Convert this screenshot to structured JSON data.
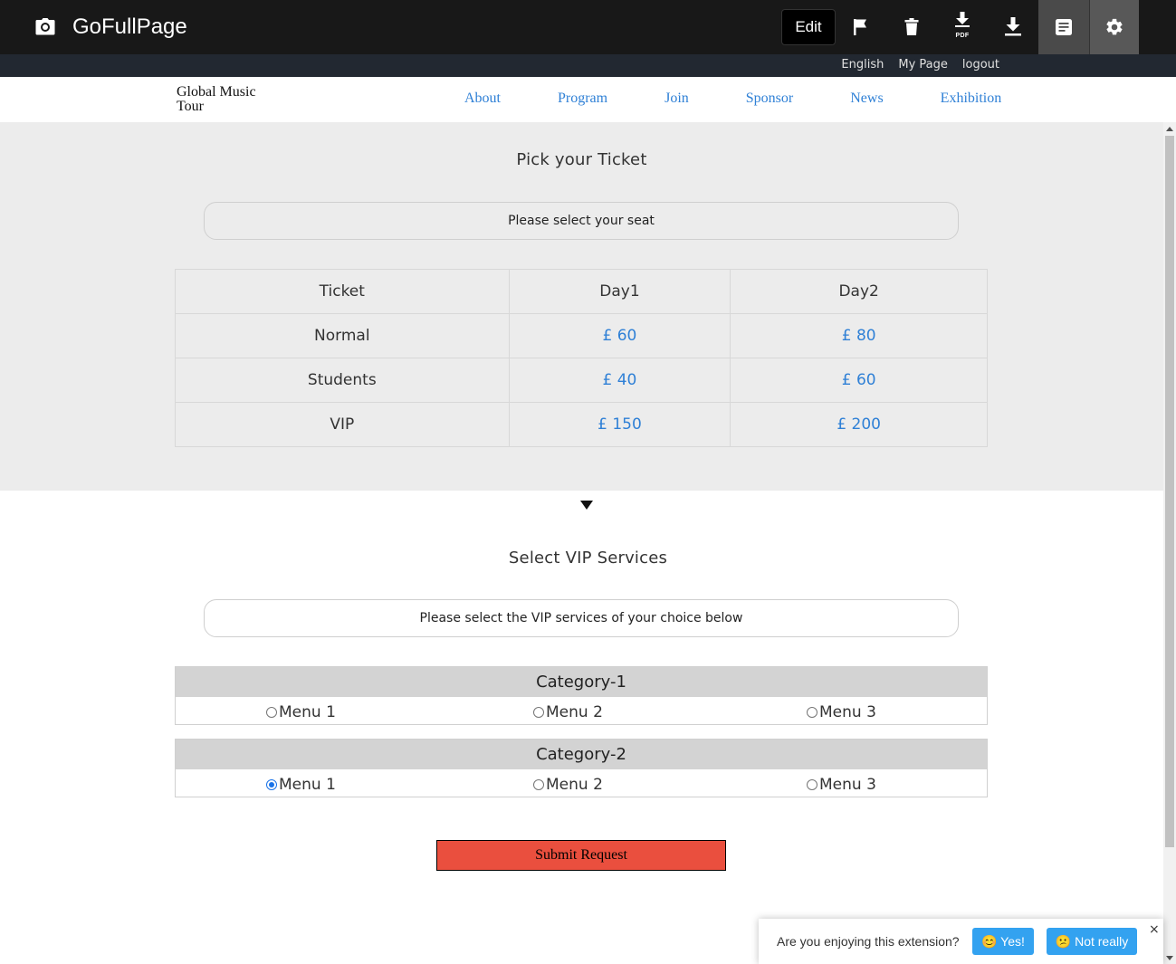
{
  "extension": {
    "title": "GoFullPage",
    "edit_label": "Edit",
    "pdf_tag": "PDF",
    "links": [
      "English",
      "My Page",
      "logout"
    ]
  },
  "site": {
    "logo": "Global Music Tour",
    "nav": [
      "About",
      "Program",
      "Join",
      "Sponsor",
      "News",
      "Exhibition"
    ]
  },
  "ticket": {
    "title": "Pick your Ticket",
    "prompt": "Please select your seat",
    "headers": [
      "Ticket",
      "Day1",
      "Day2"
    ],
    "rows": [
      {
        "type": "Normal",
        "day1": "£ 60",
        "day2": "£ 80"
      },
      {
        "type": "Students",
        "day1": "£ 40",
        "day2": "£ 60"
      },
      {
        "type": "VIP",
        "day1": "£ 150",
        "day2": "£ 200"
      }
    ]
  },
  "vip": {
    "title": "Select VIP Services",
    "prompt": "Please select the VIP services of your choice below",
    "categories": [
      {
        "name": "Category-1",
        "options": [
          "Menu 1",
          "Menu 2",
          "Menu 3"
        ],
        "selected": null
      },
      {
        "name": "Category-2",
        "options": [
          "Menu 1",
          "Menu 2",
          "Menu 3"
        ],
        "selected": "Menu 1"
      }
    ],
    "submit_label": "Submit Request"
  },
  "feedback": {
    "question": "Are you enjoying this extension?",
    "yes": "😊 Yes!",
    "no": "😕 Not really",
    "close": "×"
  },
  "colors": {
    "accent_link": "#2f80d6",
    "submit_bg": "#ea4f3e",
    "toast_button": "#33a2f0",
    "toolbar_bg": "#181818"
  }
}
